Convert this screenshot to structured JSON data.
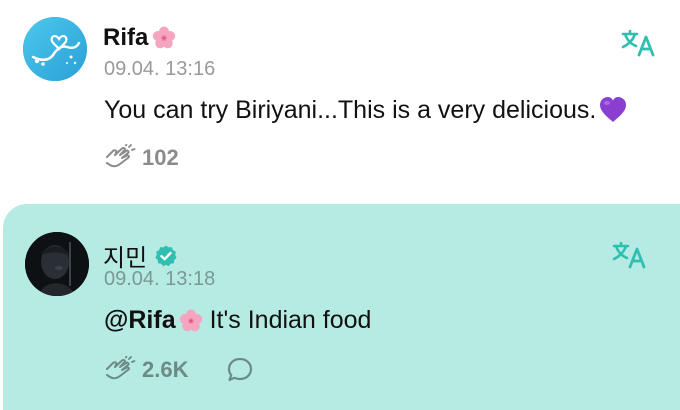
{
  "posts": [
    {
      "author": "Rifa",
      "time": "09.04. 13:16",
      "text": "You can try Biriyani...This is a very delicious.",
      "reaction_count": "102"
    },
    {
      "author": "지민",
      "time": "09.04. 13:18",
      "mention": "@Rifa",
      "text": "It's Indian food",
      "reaction_count": "2.6K"
    }
  ],
  "colors": {
    "reply_highlight": "#b5ebe3",
    "translate_icon": "#2fbfb0",
    "heart": "#8a3fd1",
    "blossom": "#f6a5c0",
    "verified": "#2fbfb0"
  },
  "icons": [
    "avatar",
    "cherry-blossom-emoji",
    "purple-heart-emoji",
    "verified-icon",
    "translate-icon",
    "reaction-icon",
    "comment-icon"
  ]
}
